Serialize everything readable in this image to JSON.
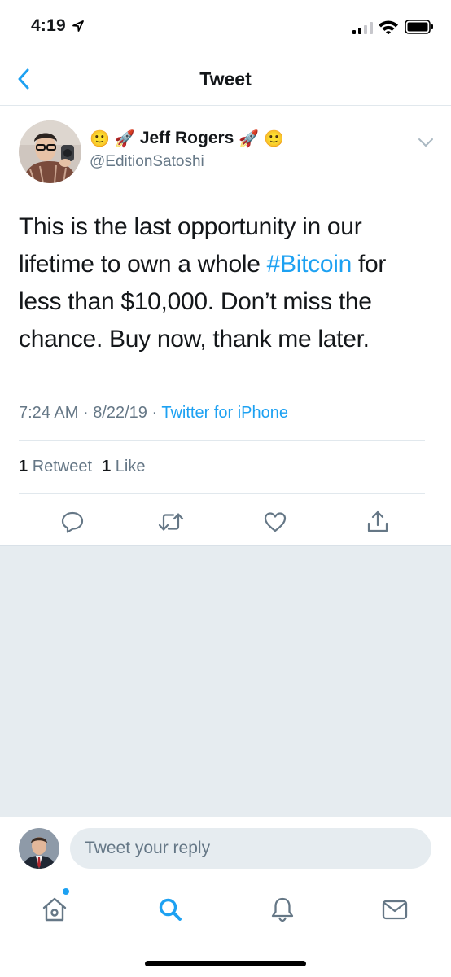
{
  "status_bar": {
    "time": "4:19"
  },
  "nav": {
    "title": "Tweet"
  },
  "tweet": {
    "name": "Jeff Rogers",
    "handle": "@EditionSatoshi",
    "text_before": "This is the last opportunity in our lifetime to own a whole ",
    "hashtag": "#Bitcoin",
    "text_after": " for less than $10,000. Don’t miss the chance. Buy now, thank me later.",
    "time": "7:24 AM",
    "date": "8/22/19",
    "source": "Twitter for iPhone",
    "retweet_count": "1",
    "retweet_label": "Retweet",
    "like_count": "1",
    "like_label": "Like"
  },
  "icons": {
    "back": "chevron-left-icon",
    "caret": "chevron-down-icon",
    "reply": "reply-icon",
    "retweet": "retweet-icon",
    "like": "heart-icon",
    "share": "share-icon",
    "tab_home": "home-icon",
    "tab_search": "search-icon",
    "tab_notifications": "bell-icon",
    "tab_messages": "mail-icon"
  },
  "reply": {
    "placeholder": "Tweet your reply"
  },
  "colors": {
    "accent": "#1da1f2",
    "secondary_text": "#657786",
    "background_gray": "#e6ecf0",
    "text": "#14171a"
  }
}
